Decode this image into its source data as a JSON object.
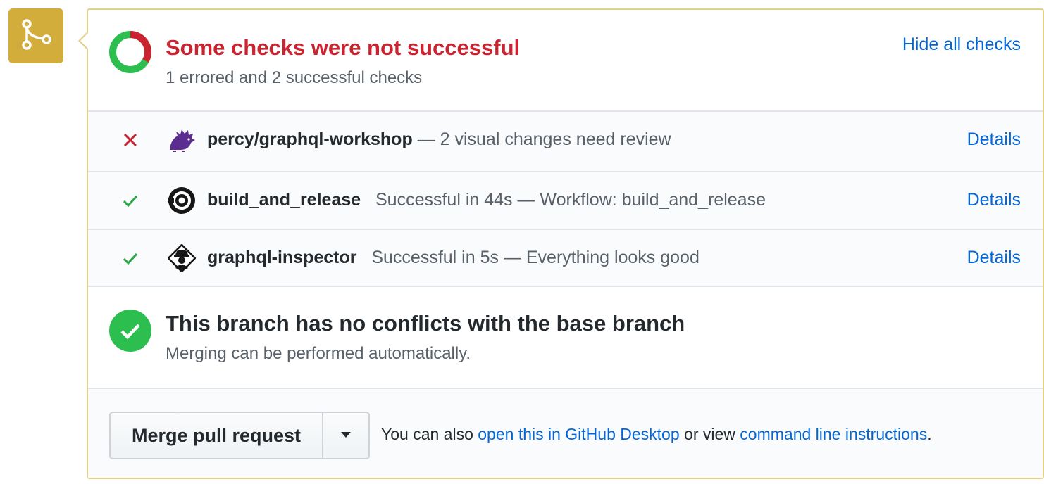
{
  "merge_badge": {
    "icon": "git-merge-icon",
    "color": "#d3ad3c"
  },
  "status": {
    "title": "Some checks were not successful",
    "subtitle": "1 errored and 2 successful checks",
    "hide_label": "Hide all checks",
    "errored": 1,
    "successful": 2,
    "colors": {
      "error": "#cb2431",
      "success": "#2cbe4e"
    }
  },
  "checks": [
    {
      "state": "error",
      "avatar": "percy-hedgehog-icon",
      "name": "percy/graphql-workshop",
      "description": " — 2 visual changes need review",
      "details_label": "Details"
    },
    {
      "state": "success",
      "avatar": "circleci-icon",
      "name": "build_and_release",
      "description": "   Successful in 44s — Workflow: build_and_release",
      "details_label": "Details"
    },
    {
      "state": "success",
      "avatar": "graphql-inspector-icon",
      "name": "graphql-inspector",
      "description": "   Successful in 5s — Everything looks good",
      "details_label": "Details"
    }
  ],
  "branch": {
    "title": "This branch has no conflicts with the base branch",
    "subtitle": "Merging can be performed automatically."
  },
  "merge": {
    "button_label": "Merge pull request",
    "info_prefix": "You can also ",
    "desktop_link": "open this in GitHub Desktop",
    "info_middle": " or view ",
    "cli_link": "command line instructions",
    "info_suffix": "."
  }
}
